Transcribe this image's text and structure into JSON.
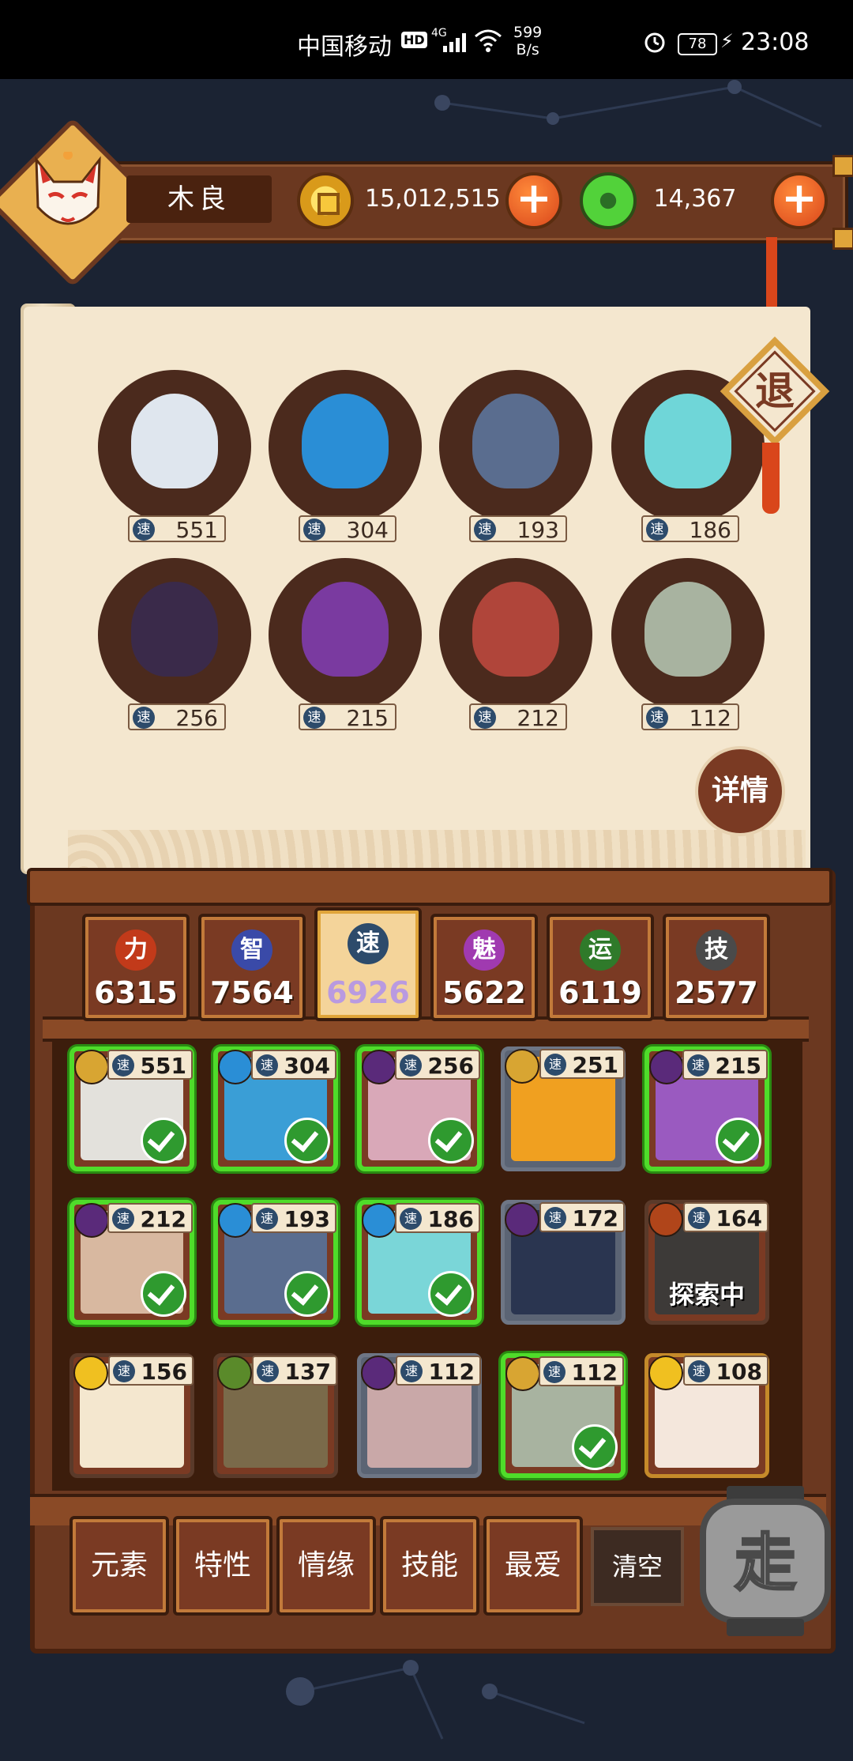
{
  "status_bar": {
    "carrier": "中国移动",
    "hd": "HD",
    "signal": "4G",
    "speed_line1": "599",
    "speed_line2": "B/s",
    "battery": "78",
    "time": "23:08"
  },
  "player": {
    "name": "木良",
    "gold": "15,012,515",
    "jade": "14,367",
    "avatar_icon": "fox-mask-icon"
  },
  "scroll_panel": {
    "retreat_label": "退",
    "detail_label": "详情",
    "speed_glyph": "速",
    "selected": [
      {
        "speed": "551",
        "color": "#dfe6ee"
      },
      {
        "speed": "304",
        "color": "#2a8ed6"
      },
      {
        "speed": "193",
        "color": "#5a6d8f"
      },
      {
        "speed": "186",
        "color": "#6fd6d8"
      },
      {
        "speed": "256",
        "color": "#3a2a4a"
      },
      {
        "speed": "215",
        "color": "#7a3aa0"
      },
      {
        "speed": "212",
        "color": "#b0453a"
      },
      {
        "speed": "112",
        "color": "#a8b3a0"
      }
    ]
  },
  "stat_tabs": [
    {
      "glyph": "力",
      "value": "6315",
      "color": "#c23a1a",
      "active": false
    },
    {
      "glyph": "智",
      "value": "7564",
      "color": "#3a4aa8",
      "active": false
    },
    {
      "glyph": "速",
      "value": "6926",
      "color": "#2d4b6b",
      "active": true
    },
    {
      "glyph": "魅",
      "value": "5622",
      "color": "#a03ab0",
      "active": false
    },
    {
      "glyph": "运",
      "value": "6119",
      "color": "#2f7a2a",
      "active": false
    },
    {
      "glyph": "技",
      "value": "2577",
      "color": "#4a4a4a",
      "active": false
    }
  ],
  "heroes": [
    {
      "speed": "551",
      "element": "#d8a532",
      "portrait": "#e3e1dc",
      "state": "selected"
    },
    {
      "speed": "304",
      "element": "#2a8ed6",
      "portrait": "#3a9ed6",
      "state": "selected"
    },
    {
      "speed": "256",
      "element": "#5a2a7a",
      "portrait": "#d9a8b8",
      "state": "selected"
    },
    {
      "speed": "251",
      "element": "#d8a532",
      "portrait": "#f0a020",
      "state": "gray"
    },
    {
      "speed": "215",
      "element": "#5a2a7a",
      "portrait": "#9a5ac0",
      "state": "selected"
    },
    {
      "speed": "212",
      "element": "#5a2a7a",
      "portrait": "#d8b8a0",
      "state": "selected"
    },
    {
      "speed": "193",
      "element": "#2a8ed6",
      "portrait": "#5a6d8f",
      "state": "selected"
    },
    {
      "speed": "186",
      "element": "#2a8ed6",
      "portrait": "#7ad6d8",
      "state": "selected"
    },
    {
      "speed": "172",
      "element": "#5a2a7a",
      "portrait": "#2a3550",
      "state": "gray"
    },
    {
      "speed": "164",
      "element": "#b0451a",
      "portrait": "#3d3a38",
      "state": "exploring",
      "label": "探索中"
    },
    {
      "speed": "156",
      "element": "#f0c020",
      "portrait": "#f4e7cf",
      "state": "normal"
    },
    {
      "speed": "137",
      "element": "#5a8a2a",
      "portrait": "#7a6a4a",
      "state": "normal"
    },
    {
      "speed": "112",
      "element": "#5a2a7a",
      "portrait": "#c9a8a8",
      "state": "gray"
    },
    {
      "speed": "112",
      "element": "#d8a532",
      "portrait": "#a8b3a0",
      "state": "selected-gold"
    },
    {
      "speed": "108",
      "element": "#f0c020",
      "portrait": "#f4e7dc",
      "state": "gold"
    }
  ],
  "filters": [
    "元素",
    "特性",
    "情缘",
    "技能",
    "最爱"
  ],
  "clear_label": "清空",
  "go_label": "走",
  "speed_glyph": "速"
}
